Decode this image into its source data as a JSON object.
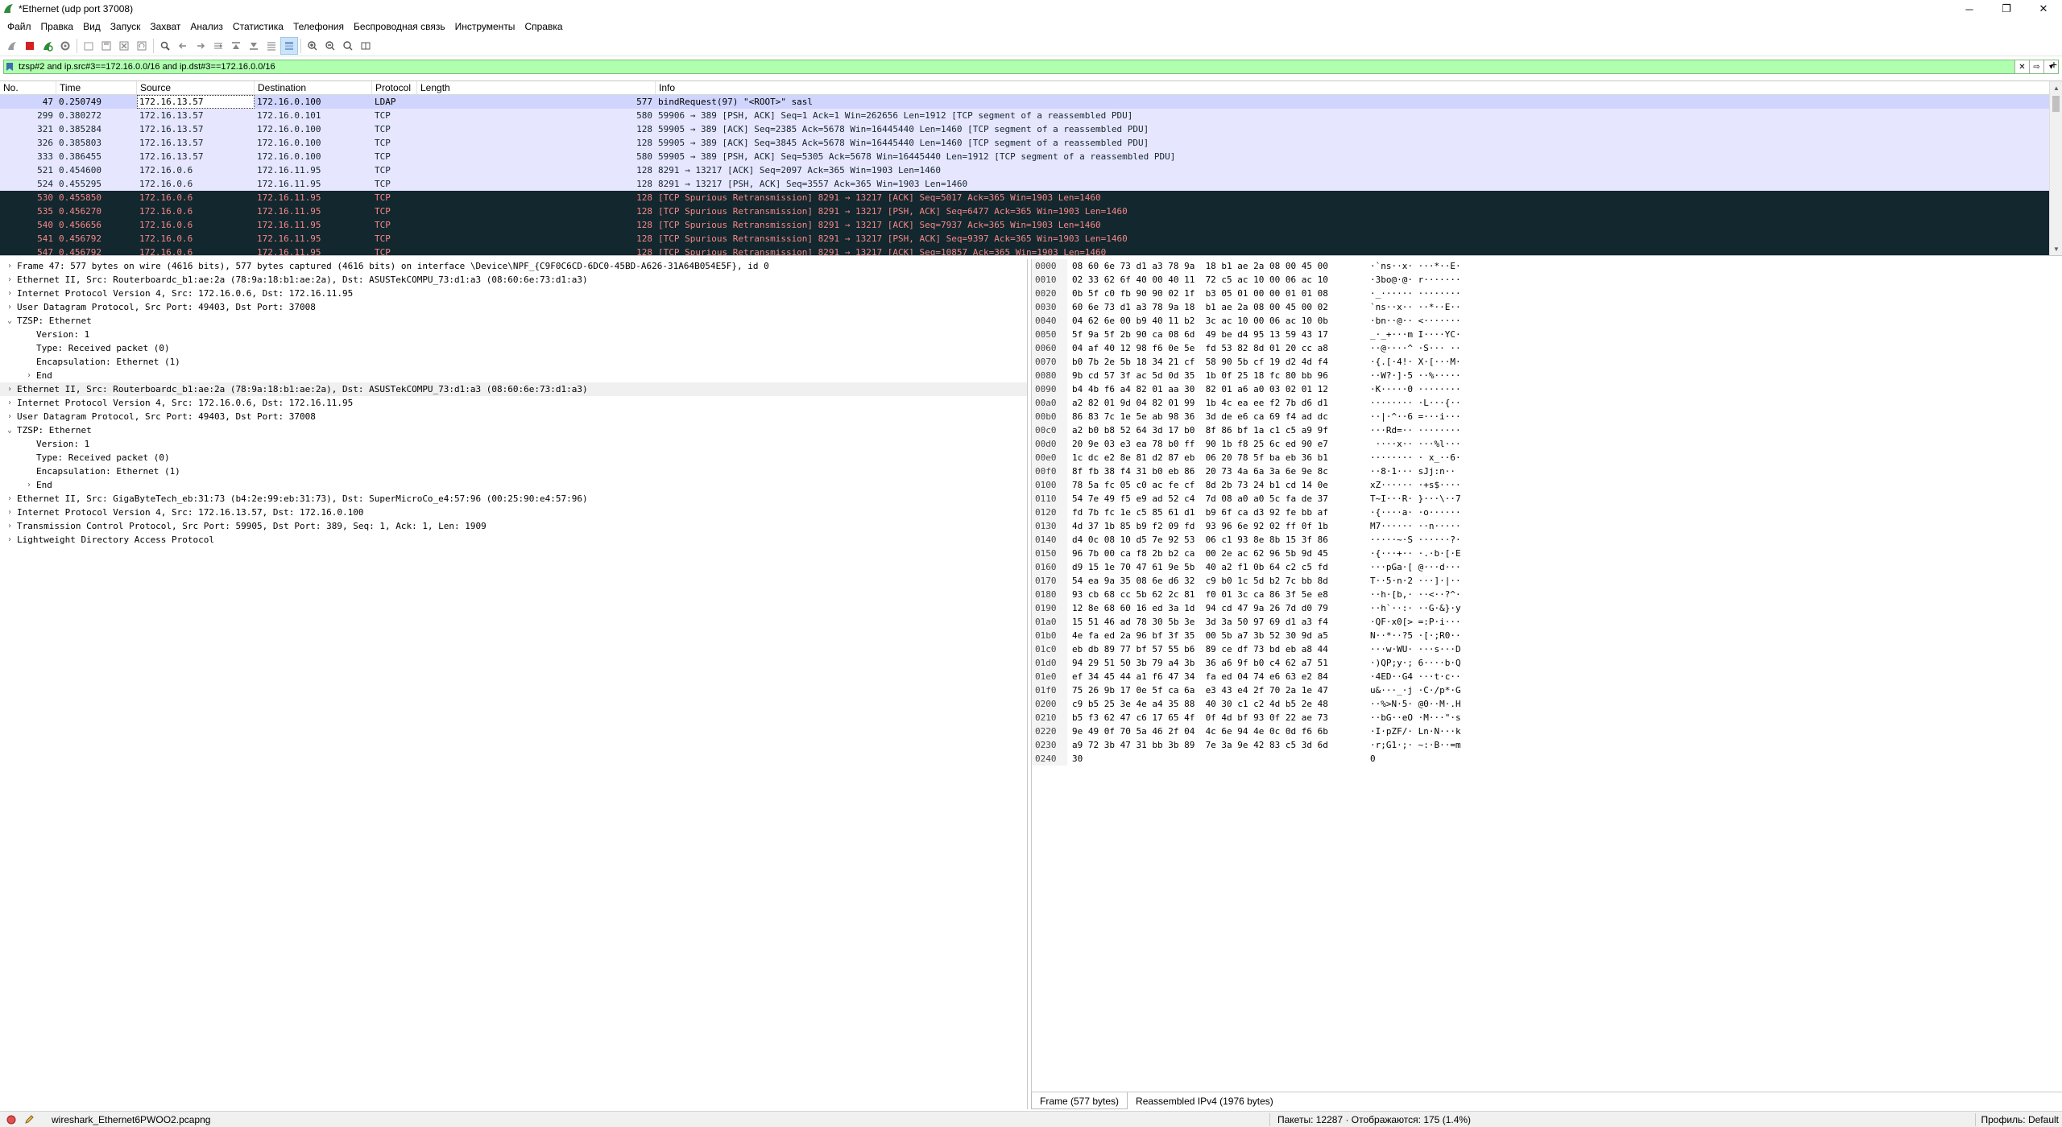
{
  "window": {
    "title": "*Ethernet (udp port 37008)",
    "minimize": "─",
    "restore": "❐",
    "close": "✕"
  },
  "menu": [
    "Файл",
    "Правка",
    "Вид",
    "Запуск",
    "Захват",
    "Анализ",
    "Статистика",
    "Телефония",
    "Беспроводная связь",
    "Инструменты",
    "Справка"
  ],
  "filter": {
    "value": "tzsp#2 and ip.src#3==172.16.0.0/16 and ip.dst#3==172.16.0.0/16"
  },
  "packet_list": {
    "columns": [
      "No.",
      "Time",
      "Source",
      "Destination",
      "Protocol",
      "Length",
      "Info"
    ],
    "rows": [
      {
        "no": "47",
        "time": "0.250749",
        "src": "172.16.13.57",
        "dst": "172.16.0.100",
        "proto": "LDAP",
        "len": "577",
        "info": "bindRequest(97) \"<ROOT>\" sasl",
        "kind": "sel"
      },
      {
        "no": "299",
        "time": "0.380272",
        "src": "172.16.13.57",
        "dst": "172.16.0.101",
        "proto": "TCP",
        "len": "580",
        "info": "59906 → 389 [PSH, ACK] Seq=1 Ack=1 Win=262656 Len=1912 [TCP segment of a reassembled PDU]",
        "kind": "tcp"
      },
      {
        "no": "321",
        "time": "0.385284",
        "src": "172.16.13.57",
        "dst": "172.16.0.100",
        "proto": "TCP",
        "len": "128",
        "info": "59905 → 389 [ACK] Seq=2385 Ack=5678 Win=16445440 Len=1460 [TCP segment of a reassembled PDU]",
        "kind": "tcp"
      },
      {
        "no": "326",
        "time": "0.385803",
        "src": "172.16.13.57",
        "dst": "172.16.0.100",
        "proto": "TCP",
        "len": "128",
        "info": "59905 → 389 [ACK] Seq=3845 Ack=5678 Win=16445440 Len=1460 [TCP segment of a reassembled PDU]",
        "kind": "tcp"
      },
      {
        "no": "333",
        "time": "0.386455",
        "src": "172.16.13.57",
        "dst": "172.16.0.100",
        "proto": "TCP",
        "len": "580",
        "info": "59905 → 389 [PSH, ACK] Seq=5305 Ack=5678 Win=16445440 Len=1912 [TCP segment of a reassembled PDU]",
        "kind": "tcp"
      },
      {
        "no": "521",
        "time": "0.454600",
        "src": "172.16.0.6",
        "dst": "172.16.11.95",
        "proto": "TCP",
        "len": "128",
        "info": "8291 → 13217 [ACK] Seq=2097 Ack=365 Win=1903 Len=1460",
        "kind": "tcp"
      },
      {
        "no": "524",
        "time": "0.455295",
        "src": "172.16.0.6",
        "dst": "172.16.11.95",
        "proto": "TCP",
        "len": "128",
        "info": "8291 → 13217 [PSH, ACK] Seq=3557 Ack=365 Win=1903 Len=1460",
        "kind": "tcp"
      },
      {
        "no": "530",
        "time": "0.455850",
        "src": "172.16.0.6",
        "dst": "172.16.11.95",
        "proto": "TCP",
        "len": "128",
        "info": "[TCP Spurious Retransmission] 8291 → 13217 [ACK] Seq=5017 Ack=365 Win=1903 Len=1460",
        "kind": "bad"
      },
      {
        "no": "535",
        "time": "0.456270",
        "src": "172.16.0.6",
        "dst": "172.16.11.95",
        "proto": "TCP",
        "len": "128",
        "info": "[TCP Spurious Retransmission] 8291 → 13217 [PSH, ACK] Seq=6477 Ack=365 Win=1903 Len=1460",
        "kind": "bad"
      },
      {
        "no": "540",
        "time": "0.456656",
        "src": "172.16.0.6",
        "dst": "172.16.11.95",
        "proto": "TCP",
        "len": "128",
        "info": "[TCP Spurious Retransmission] 8291 → 13217 [ACK] Seq=7937 Ack=365 Win=1903 Len=1460",
        "kind": "bad"
      },
      {
        "no": "541",
        "time": "0.456792",
        "src": "172.16.0.6",
        "dst": "172.16.11.95",
        "proto": "TCP",
        "len": "128",
        "info": "[TCP Spurious Retransmission] 8291 → 13217 [PSH, ACK] Seq=9397 Ack=365 Win=1903 Len=1460",
        "kind": "bad"
      },
      {
        "no": "547",
        "time": "0.456792",
        "src": "172.16.0.6",
        "dst": "172.16.11.95",
        "proto": "TCP",
        "len": "128",
        "info": "[TCP Spurious Retransmission] 8291 → 13217 [ACK] Seq=10857 Ack=365 Win=1903 Len=1460",
        "kind": "bad"
      }
    ]
  },
  "details": [
    {
      "arrow": "›",
      "indent": 0,
      "text": "Frame 47: 577 bytes on wire (4616 bits), 577 bytes captured (4616 bits) on interface \\Device\\NPF_{C9F0C6CD-6DC0-45BD-A626-31A64B054E5F}, id 0"
    },
    {
      "arrow": "›",
      "indent": 0,
      "text": "Ethernet II, Src: Routerboardc_b1:ae:2a (78:9a:18:b1:ae:2a), Dst: ASUSTekCOMPU_73:d1:a3 (08:60:6e:73:d1:a3)"
    },
    {
      "arrow": "›",
      "indent": 0,
      "text": "Internet Protocol Version 4, Src: 172.16.0.6, Dst: 172.16.11.95"
    },
    {
      "arrow": "›",
      "indent": 0,
      "text": "User Datagram Protocol, Src Port: 49403, Dst Port: 37008"
    },
    {
      "arrow": "⌄",
      "indent": 0,
      "text": "TZSP: Ethernet"
    },
    {
      "arrow": "",
      "indent": 1,
      "text": "Version: 1"
    },
    {
      "arrow": "",
      "indent": 1,
      "text": "Type: Received packet (0)"
    },
    {
      "arrow": "",
      "indent": 1,
      "text": "Encapsulation: Ethernet (1)"
    },
    {
      "arrow": "›",
      "indent": 1,
      "text": "End"
    },
    {
      "arrow": "›",
      "indent": 0,
      "text": "Ethernet II, Src: Routerboardc_b1:ae:2a (78:9a:18:b1:ae:2a), Dst: ASUSTekCOMPU_73:d1:a3 (08:60:6e:73:d1:a3)",
      "sel": true
    },
    {
      "arrow": "›",
      "indent": 0,
      "text": "Internet Protocol Version 4, Src: 172.16.0.6, Dst: 172.16.11.95"
    },
    {
      "arrow": "›",
      "indent": 0,
      "text": "User Datagram Protocol, Src Port: 49403, Dst Port: 37008"
    },
    {
      "arrow": "⌄",
      "indent": 0,
      "text": "TZSP: Ethernet"
    },
    {
      "arrow": "",
      "indent": 1,
      "text": "Version: 1"
    },
    {
      "arrow": "",
      "indent": 1,
      "text": "Type: Received packet (0)"
    },
    {
      "arrow": "",
      "indent": 1,
      "text": "Encapsulation: Ethernet (1)"
    },
    {
      "arrow": "›",
      "indent": 1,
      "text": "End"
    },
    {
      "arrow": "›",
      "indent": 0,
      "text": "Ethernet II, Src: GigaByteTech_eb:31:73 (b4:2e:99:eb:31:73), Dst: SuperMicroCo_e4:57:96 (00:25:90:e4:57:96)"
    },
    {
      "arrow": "›",
      "indent": 0,
      "text": "Internet Protocol Version 4, Src: 172.16.13.57, Dst: 172.16.0.100"
    },
    {
      "arrow": "›",
      "indent": 0,
      "text": "Transmission Control Protocol, Src Port: 59905, Dst Port: 389, Seq: 1, Ack: 1, Len: 1909"
    },
    {
      "arrow": "›",
      "indent": 0,
      "text": "Lightweight Directory Access Protocol"
    }
  ],
  "hex": [
    {
      "off": "0000",
      "bytes": "08 60 6e 73 d1 a3 78 9a  18 b1 ae 2a 08 00 45 00",
      "ascii": "·`ns··x· ···*··E·"
    },
    {
      "off": "0010",
      "bytes": "02 33 62 6f 40 00 40 11  72 c5 ac 10 00 06 ac 10",
      "ascii": "·3bo@·@· r·······"
    },
    {
      "off": "0020",
      "bytes": "0b 5f c0 fb 90 90 02 1f  b3 05 01 00 00 01 01 08",
      "ascii": "·_······ ········"
    },
    {
      "off": "0030",
      "bytes": "60 6e 73 d1 a3 78 9a 18  b1 ae 2a 08 00 45 00 02",
      "ascii": "`ns··x·· ··*··E··"
    },
    {
      "off": "0040",
      "bytes": "04 62 6e 00 b9 40 11 b2  3c ac 10 00 06 ac 10 0b",
      "ascii": "·bn··@·· <·······"
    },
    {
      "off": "0050",
      "bytes": "5f 9a 5f 2b 90 ca 08 6d  49 be d4 95 13 59 43 17",
      "ascii": "_·_+···m I····YC·"
    },
    {
      "off": "0060",
      "bytes": "04 af 40 12 98 f6 0e 5e  fd 53 82 8d 01 20 cc a8",
      "ascii": "··@····^ ·S··· ··"
    },
    {
      "off": "0070",
      "bytes": "b0 7b 2e 5b 18 34 21 cf  58 90 5b cf 19 d2 4d f4",
      "ascii": "·{.[·4!· X·[···M·"
    },
    {
      "off": "0080",
      "bytes": "9b cd 57 3f ac 5d 0d 35  1b 0f 25 18 fc 80 bb 96",
      "ascii": "··W?·]·5 ··%·····"
    },
    {
      "off": "0090",
      "bytes": "b4 4b f6 a4 82 01 aa 30  82 01 a6 a0 03 02 01 12",
      "ascii": "·K·····0 ········"
    },
    {
      "off": "00a0",
      "bytes": "a2 82 01 9d 04 82 01 99  1b 4c ea ee f2 7b d6 d1",
      "ascii": "········ ·L···{··"
    },
    {
      "off": "00b0",
      "bytes": "86 83 7c 1e 5e ab 98 36  3d de e6 ca 69 f4 ad dc",
      "ascii": "··|·^··6 =···i···"
    },
    {
      "off": "00c0",
      "bytes": "a2 b0 b8 52 64 3d 17 b0  8f 86 bf 1a c1 c5 a9 9f",
      "ascii": "···Rd=·· ········"
    },
    {
      "off": "00d0",
      "bytes": "20 9e 03 e3 ea 78 b0 ff  90 1b f8 25 6c ed 90 e7",
      "ascii": " ····x·· ···%l···"
    },
    {
      "off": "00e0",
      "bytes": "1c dc e2 8e 81 d2 87 eb  06 20 78 5f ba eb 36 b1",
      "ascii": "········ · x_··6·"
    },
    {
      "off": "00f0",
      "bytes": "8f fb 38 f4 31 b0 eb 86  20 73 4a 6a 3a 6e 9e 8c",
      "ascii": "··8·1··· sJj:n··"
    },
    {
      "off": "0100",
      "bytes": "78 5a fc 05 c0 ac fe cf  8d 2b 73 24 b1 cd 14 0e",
      "ascii": "xZ······ ·+s$····"
    },
    {
      "off": "0110",
      "bytes": "54 7e 49 f5 e9 ad 52 c4  7d 08 a0 a0 5c fa de 37",
      "ascii": "T~I···R· }···\\··7"
    },
    {
      "off": "0120",
      "bytes": "fd 7b fc 1e c5 85 61 d1  b9 6f ca d3 92 fe bb af",
      "ascii": "·{····a· ·o······"
    },
    {
      "off": "0130",
      "bytes": "4d 37 1b 85 b9 f2 09 fd  93 96 6e 92 02 ff 0f 1b",
      "ascii": "M7······ ··n·····"
    },
    {
      "off": "0140",
      "bytes": "d4 0c 08 10 d5 7e 92 53  06 c1 93 8e 8b 15 3f 86",
      "ascii": "·····~·S ······?·"
    },
    {
      "off": "0150",
      "bytes": "96 7b 00 ca f8 2b b2 ca  00 2e ac 62 96 5b 9d 45",
      "ascii": "·{···+·· ·.·b·[·E"
    },
    {
      "off": "0160",
      "bytes": "d9 15 1e 70 47 61 9e 5b  40 a2 f1 0b 64 c2 c5 fd",
      "ascii": "···pGa·[ @···d···"
    },
    {
      "off": "0170",
      "bytes": "54 ea 9a 35 08 6e d6 32  c9 b0 1c 5d b2 7c bb 8d",
      "ascii": "T··5·n·2 ···]·|··"
    },
    {
      "off": "0180",
      "bytes": "93 cb 68 cc 5b 62 2c 81  f0 01 3c ca 86 3f 5e e8",
      "ascii": "··h·[b,· ··<··?^·"
    },
    {
      "off": "0190",
      "bytes": "12 8e 68 60 16 ed 3a 1d  94 cd 47 9a 26 7d d0 79",
      "ascii": "··h`··:· ··G·&}·y"
    },
    {
      "off": "01a0",
      "bytes": "15 51 46 ad 78 30 5b 3e  3d 3a 50 97 69 d1 a3 f4",
      "ascii": "·QF·x0[> =:P·i···"
    },
    {
      "off": "01b0",
      "bytes": "4e fa ed 2a 96 bf 3f 35  00 5b a7 3b 52 30 9d a5",
      "ascii": "N··*··?5 ·[·;R0··"
    },
    {
      "off": "01c0",
      "bytes": "eb db 89 77 bf 57 55 b6  89 ce df 73 bd eb a8 44",
      "ascii": "···w·WU· ···s···D"
    },
    {
      "off": "01d0",
      "bytes": "94 29 51 50 3b 79 a4 3b  36 a6 9f b0 c4 62 a7 51",
      "ascii": "·)QP;y·; 6····b·Q"
    },
    {
      "off": "01e0",
      "bytes": "ef 34 45 44 a1 f6 47 34  fa ed 04 74 e6 63 e2 84",
      "ascii": "·4ED··G4 ···t·c··"
    },
    {
      "off": "01f0",
      "bytes": "75 26 9b 17 0e 5f ca 6a  e3 43 e4 2f 70 2a 1e 47",
      "ascii": "u&···_·j ·C·/p*·G"
    },
    {
      "off": "0200",
      "bytes": "c9 b5 25 3e 4e a4 35 88  40 30 c1 c2 4d b5 2e 48",
      "ascii": "··%>N·5· @0··M·.H"
    },
    {
      "off": "0210",
      "bytes": "b5 f3 62 47 c6 17 65 4f  0f 4d bf 93 0f 22 ae 73",
      "ascii": "··bG··eO ·M···\"·s"
    },
    {
      "off": "0220",
      "bytes": "9e 49 0f 70 5a 46 2f 04  4c 6e 94 4e 0c 0d f6 6b",
      "ascii": "·I·pZF/· Ln·N···k"
    },
    {
      "off": "0230",
      "bytes": "a9 72 3b 47 31 bb 3b 89  7e 3a 9e 42 83 c5 3d 6d",
      "ascii": "·r;G1·;· ~:·B··=m"
    },
    {
      "off": "0240",
      "bytes": "30",
      "ascii": "0"
    }
  ],
  "hex_tabs": [
    "Frame (577 bytes)",
    "Reassembled IPv4 (1976 bytes)"
  ],
  "status": {
    "file": "wireshark_Ethernet6PWOO2.pcapng",
    "packets": "Пакеты: 12287 · Отображаются: 175 (1.4%)",
    "profile": "Профиль: Default"
  },
  "colors": {
    "filter_bg": "#afffaf",
    "tcp_row": "#e7e6ff",
    "bad_row_bg": "#12272e",
    "bad_row_fg": "#f78787"
  }
}
